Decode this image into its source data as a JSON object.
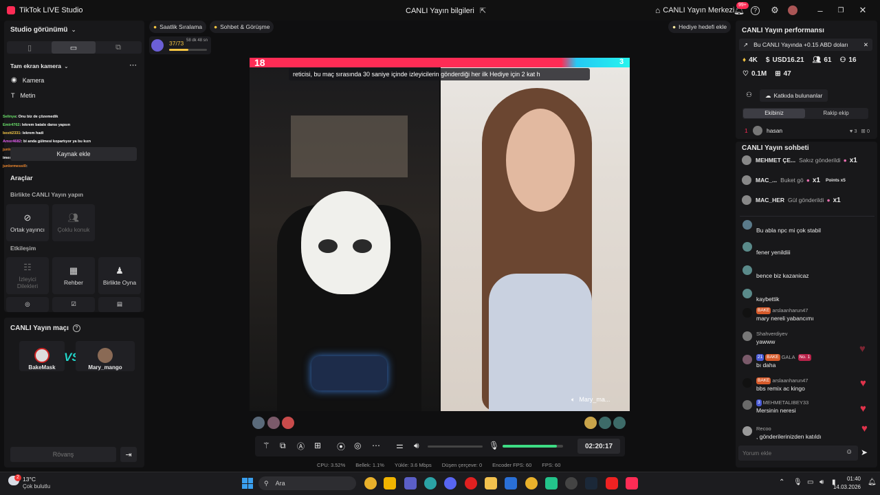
{
  "titlebar": {
    "app_name": "TikTok LIVE Studio",
    "center_title": "CANLI Yayın bilgileri",
    "live_center": "CANLI Yayın Merkezi",
    "notif_count": "99+"
  },
  "left": {
    "studio_view": "Studio görünümü",
    "fullscreen_camera": "Tam ekran kamera",
    "camera": "Kamera",
    "text": "Metin",
    "add_source": "Kaynak ekle",
    "overlay_chat": [
      {
        "user": "Selinya",
        "text": ": Onu biz de çözemedik",
        "color": "#6be36b"
      },
      {
        "user": "Emir4762",
        "text": ": lekrem batalo dansı yapsın",
        "color": "#6be36b"
      },
      {
        "user": "bestt2331",
        "text": ": lekrem hadi",
        "color": "#f7c948"
      },
      {
        "user": "Amor4682",
        "text": ": bi anda gülmesi kopartıyor ya bu kızn",
        "color": "#e45ef0"
      },
      {
        "user": "junlormessi0",
        "text": ":",
        "color": "#f28a2e"
      },
      {
        "user": "imessi40",
        "text": ":",
        "color": "#ffffff"
      },
      {
        "user": "junlormessi0",
        "text": ":",
        "color": "#f28a2e"
      }
    ],
    "tools": "Araçlar",
    "together_live": "Birlikte CANLI Yayın yapın",
    "co_host": "Ortak yayıncı",
    "multi_guest": "Çoklu konuk",
    "interaction": "Etkileşim",
    "viewer_requests": "İzleyici Dilekleri",
    "guide": "Rehber",
    "play_together": "Birlikte Oyna",
    "match_title": "CANLI Yayın maçı",
    "player1": "BakeMask",
    "player2": "Mary_mango",
    "vs": "VS",
    "rematch": "Rövanş"
  },
  "center": {
    "hourly_ranking": "Saatlik Sıralama",
    "chat_meet": "Sohbet & Görüşme",
    "add_gift_goal": "Hediye hedefi ekle",
    "goal_progress": "37/73",
    "goal_progress_fraction": 0.51,
    "goal_timer": "58 dk 48 sn",
    "score_left": "18",
    "score_right": "3",
    "banner": "reticisi, bu maç sırasında 30 saniye içinde izleyicilerin gönderdiği her ilk Hediye için 2 kat h",
    "name_tag": "Mary_ma...",
    "timer": "02:20:17",
    "mic_level": 0.9,
    "stats": {
      "cpu": "CPU:  3.52%",
      "memory": "Bellek:  1.1%",
      "upload": "Yükle:  3.6 Mbps",
      "dropped": "Düşen çerçeve:  0",
      "encoder_fps": "Encoder FPS:  60",
      "fps": "FPS:  60"
    }
  },
  "right": {
    "perf_title": "CANLI Yayın performansı",
    "earn_note": "Bu CANLI Yayında +0.15 ABD doları",
    "stat_hearts": "4K",
    "stat_usd": "USD16.21",
    "stat_viewers": "61",
    "stat_new": "16",
    "stat_likes": "0.1M",
    "stat_gifts": "47",
    "contributors": "Katkıda bulunanlar",
    "tab_team": "Ekibiniz",
    "tab_rival": "Rakip ekip",
    "top_rank": "1",
    "top_user": "hasan",
    "top_user_hearts": "3",
    "top_user_gifts": "0",
    "chat_title": "CANLI Yayın sohbeti",
    "gift_rows": [
      {
        "user": "MEHMET ÇE...",
        "text": "Sakız gönderildi",
        "count": "x1"
      },
      {
        "user": "MAC_...",
        "text": "Buket gö",
        "count": "x1",
        "extra": "Points x5"
      },
      {
        "user": "MAC_HER",
        "text": "Gül gönderildi",
        "count": "x1"
      }
    ],
    "chat": [
      {
        "user": "",
        "text": "Bu abla npc mi çok stabil"
      },
      {
        "user": "",
        "text": "fener yenildiii"
      },
      {
        "user": "",
        "text": "bence biz kazanicaz"
      },
      {
        "user": "",
        "text": "kaybettik"
      },
      {
        "user": "arslaanharun47",
        "badge": "BAKE",
        "text": "mary nereli yabancımı"
      },
      {
        "user": "Shahverdiyev",
        "text": "yawww"
      },
      {
        "user": "GALA",
        "badge": "BAKE",
        "level": "21",
        "extra": "No. 1",
        "text": "bı daha"
      },
      {
        "user": "arslaanharun47",
        "badge": "BAKE",
        "text": "bbs remix ac kingo"
      },
      {
        "user": "MEHMETALIBEY33",
        "level": "3",
        "text": "Mersinin neresi"
      },
      {
        "user": "Recoo",
        "text": ", gönderilerinizden katıldı"
      }
    ],
    "comment_placeholder": "Yorum ekle"
  },
  "taskbar": {
    "temp": "13°C",
    "weather": "Çok bulutlu",
    "weather_badge": "2",
    "search": "Ara",
    "time": "01:40",
    "date": "14.03.2026"
  },
  "colors": {
    "accent_pink": "#fe2c55",
    "accent_cyan": "#25f4ee",
    "green": "#3ddc84"
  }
}
